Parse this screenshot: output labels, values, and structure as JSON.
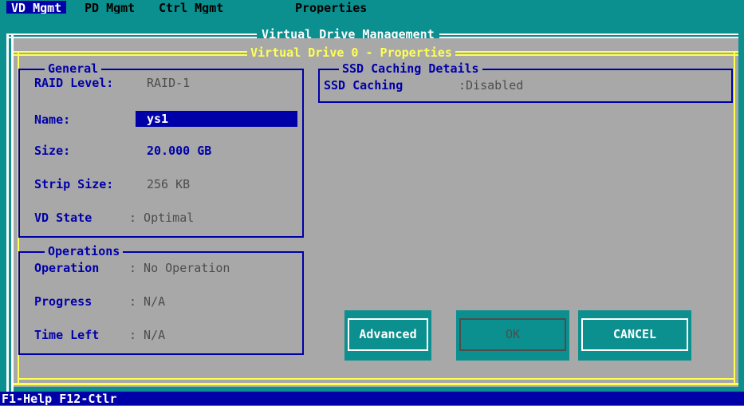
{
  "menu": [
    {
      "label": "VD Mgmt",
      "active": true
    },
    {
      "label": "PD Mgmt",
      "active": false
    },
    {
      "label": "Ctrl Mgmt",
      "active": false
    },
    {
      "label": "Properties",
      "active": false
    }
  ],
  "outer_title": "Virtual Drive Management",
  "inner_title": "Virtual Drive 0 - Properties",
  "general": {
    "title": "General",
    "raid_label": "RAID Level:",
    "raid_value": "RAID-1",
    "name_label": "Name:",
    "name_value": "ys1",
    "size_label": "Size:",
    "size_value": "20.000 GB",
    "strip_label": "Strip Size:",
    "strip_value": "256 KB",
    "state_label": "VD State",
    "state_value": ": Optimal"
  },
  "operations": {
    "title": "Operations",
    "operation_label": "Operation",
    "operation_value": ": No Operation",
    "progress_label": "Progress",
    "progress_value": ": N/A",
    "timeleft_label": "Time Left",
    "timeleft_value": ": N/A"
  },
  "ssd": {
    "title": "SSD Caching Details",
    "caching_label": "SSD Caching",
    "caching_value": ":Disabled"
  },
  "buttons": {
    "advanced": "Advanced",
    "ok": "OK",
    "cancel": "CANCEL"
  },
  "status": "F1-Help F12-Ctlr",
  "colors": {
    "background": "#0b8f8f",
    "panel": "#a8a8a8",
    "accent": "#0000a8",
    "highlight": "#ffff55"
  }
}
